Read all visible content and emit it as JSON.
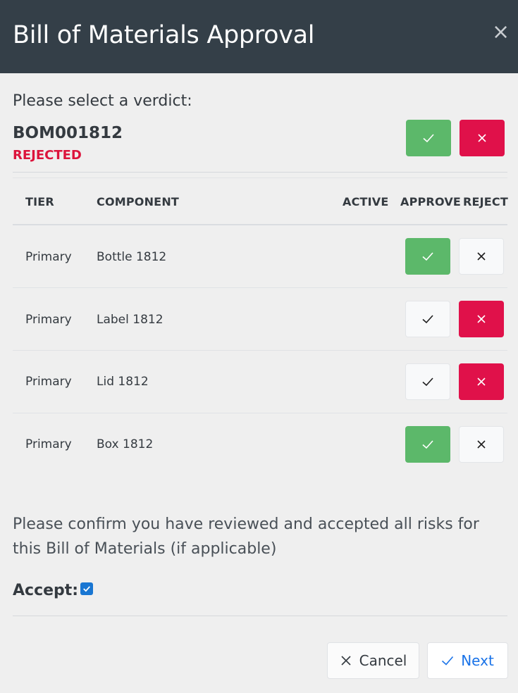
{
  "dialog": {
    "title": "Bill of Materials Approval"
  },
  "verdict": {
    "prompt": "Please select a verdict:",
    "bom_id": "BOM001812",
    "status": "REJECTED",
    "status_color": "#dc143c"
  },
  "table": {
    "headers": {
      "tier": "TIER",
      "component": "COMPONENT",
      "active": "ACTIVE",
      "approve": "APPROVE",
      "reject": "REJECT"
    },
    "rows": [
      {
        "tier": "Primary",
        "component": "Bottle 1812",
        "verdict": "approved"
      },
      {
        "tier": "Primary",
        "component": "Label 1812",
        "verdict": "rejected"
      },
      {
        "tier": "Primary",
        "component": "Lid 1812",
        "verdict": "rejected"
      },
      {
        "tier": "Primary",
        "component": "Box 1812",
        "verdict": "approved"
      }
    ]
  },
  "confirmation": {
    "text": "Please confirm you have reviewed and accepted all risks for this Bill of Materials (if applicable)",
    "accept_label": "Accept:",
    "accepted": true
  },
  "footer": {
    "cancel_label": "Cancel",
    "next_label": "Next"
  },
  "colors": {
    "header_bg": "#343f48",
    "approve_green": "#5cb86a",
    "reject_red": "#e0114a",
    "link_blue": "#1a73e8"
  }
}
